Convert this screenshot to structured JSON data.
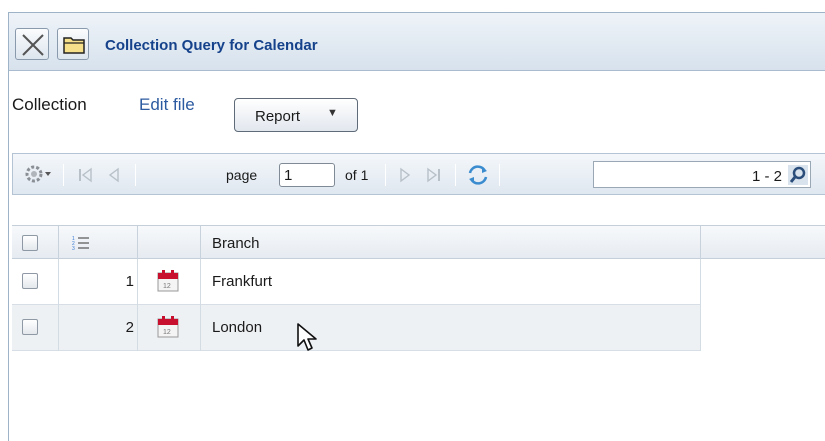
{
  "window": {
    "title": "Collection Query for Calendar",
    "close_icon": "close-icon",
    "folder_icon": "folder-icon"
  },
  "menu": {
    "collection_label": "Collection",
    "edit_file_label": "Edit file",
    "report_label": "Report"
  },
  "toolbar": {
    "gear_icon": "gear-icon",
    "page_label": "page",
    "page_value": "1",
    "of_label": "of 1",
    "range_text": "1 - 2",
    "search_icon": "search-icon"
  },
  "grid": {
    "columns": [
      "",
      "",
      "",
      "Branch"
    ],
    "rows": [
      {
        "num": "1",
        "icon": "calendar-icon",
        "branch": "Frankfurt"
      },
      {
        "num": "2",
        "icon": "calendar-icon",
        "branch": "London"
      }
    ]
  },
  "colors": {
    "title_text": "#15428b",
    "link_text": "#2c5aa0",
    "calendar_red": "#c8102e"
  }
}
